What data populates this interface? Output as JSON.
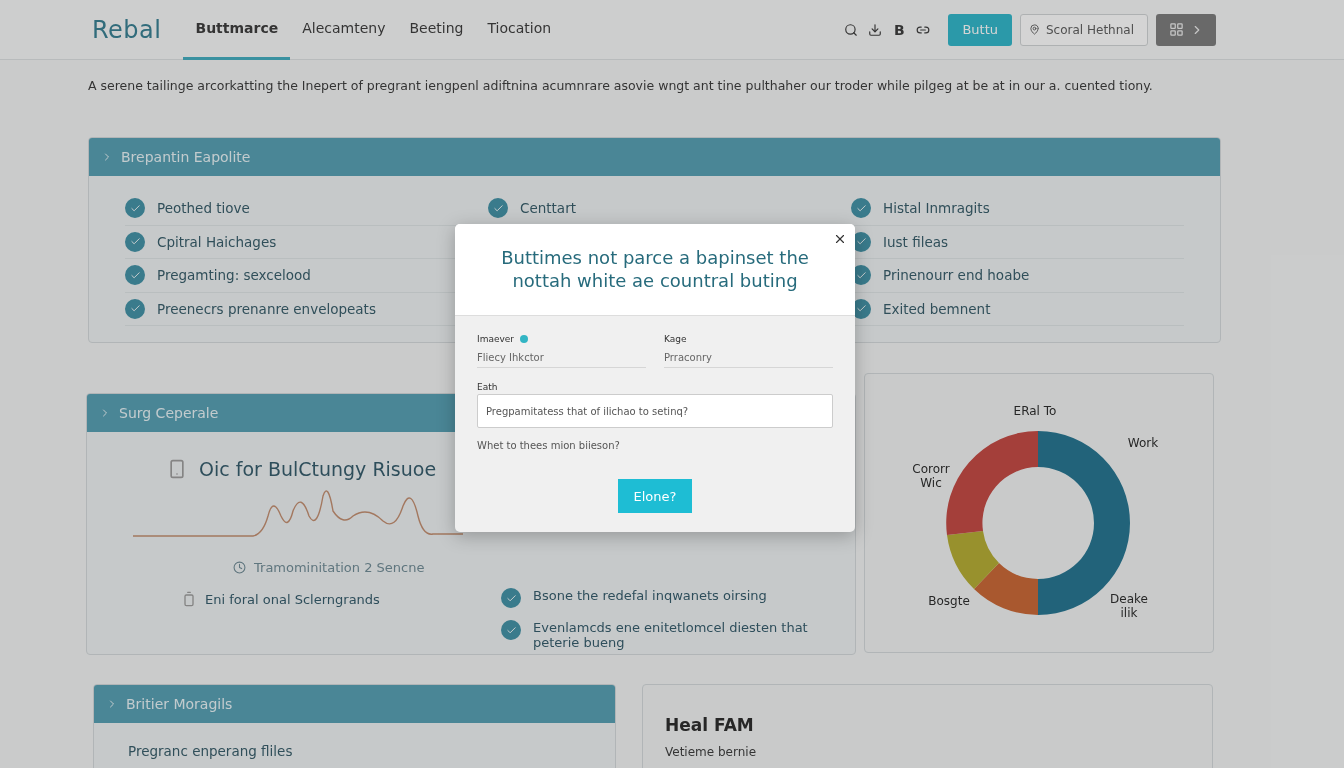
{
  "header": {
    "logo": "Rebal",
    "tabs": [
      {
        "label": "Buttmarce",
        "selected": true
      },
      {
        "label": "Alecamteny",
        "selected": false
      },
      {
        "label": "Beeting",
        "selected": false
      },
      {
        "label": "Tiocation",
        "selected": false
      }
    ],
    "bold_icon": "B",
    "button": "Buttu",
    "search": {
      "value": "Scoral Hethnal"
    }
  },
  "intro": "A serene tailinge arcorkatting the Inepert of pregrant iengpenl adiftnina acumnrare asovie wngt ant tine pulthaher our troder while pilgeg at be at in our a. cuented tiony.",
  "panel_1": {
    "title": "Brepantin Eapolite",
    "columns": [
      [
        {
          "label": "Peothed tiove",
          "checked": true
        },
        {
          "label": "Cpitral Haichages",
          "checked": true
        },
        {
          "label": "Pregamting: sexcelood",
          "checked": true
        },
        {
          "label": "Preenecrs prenanre envelopeats",
          "checked": true
        }
      ],
      [
        {
          "label": "Centtart",
          "checked": true
        }
      ],
      [
        {
          "label": "Histal Inmragits",
          "checked": true
        },
        {
          "label": "Iust fileas",
          "checked": true
        },
        {
          "label": "Prinenourr end hoabe",
          "checked": true
        },
        {
          "label": "Exited bemnent",
          "checked": true
        }
      ]
    ]
  },
  "panel_2": {
    "title": "Surg Ceperale",
    "heading": "Oic for BulCtungy Risuoe",
    "caption": "Tramominitation 2 Sencne",
    "footer": "Eni foral onal Sclerngrands",
    "items": [
      {
        "label": "Bsone the redefal inqwanets oirsing",
        "checked": true
      },
      {
        "label": "Evenlamcds ene enitetlomcel diesten that peterie bueng",
        "checked": true
      }
    ]
  },
  "donut": {
    "labels": [
      "ERal To",
      "Work",
      "Cororr Wic",
      "Bosgte",
      "Deake ilik"
    ]
  },
  "panel_3": {
    "title": "Britier Moragils",
    "item": "Pregranc enperang fliles"
  },
  "card_4": {
    "title": "Heal FAM",
    "subtitle": "Vetieme bernie"
  },
  "modal": {
    "title": "Buttimes not parce a bapinset the nottah white ae countral buting",
    "fields": [
      {
        "label": "Imaever",
        "value": "Fliecy Ihkctor",
        "required": true
      },
      {
        "label": "Kage",
        "value": "Prraconry"
      }
    ],
    "text_label": "Eath",
    "text_value": "Pregpamitatess that of ilichao to setinq?",
    "hint": "Whet to thees mion biieson?",
    "button": "Elone?"
  }
}
